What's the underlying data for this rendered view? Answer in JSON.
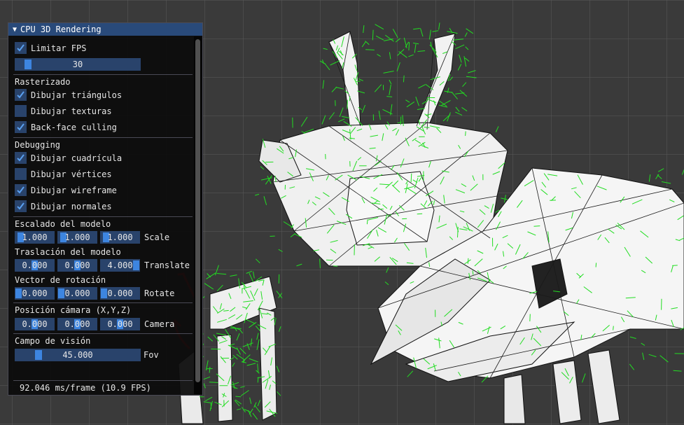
{
  "window": {
    "title": "CPU 3D Rendering",
    "limit_fps": {
      "label": "Limitar FPS",
      "checked": true
    },
    "fps_slider": {
      "value": "30",
      "fraction": 0.1
    },
    "rasterized": {
      "header": "Rasterizado",
      "items": [
        {
          "label": "Dibujar triángulos",
          "checked": true
        },
        {
          "label": "Dibujar texturas",
          "checked": false
        },
        {
          "label": "Back-face culling",
          "checked": true
        }
      ]
    },
    "debugging": {
      "header": "Debugging",
      "items": [
        {
          "label": "Dibujar cuadrícula",
          "checked": true
        },
        {
          "label": "Dibujar vértices",
          "checked": false
        },
        {
          "label": "Dibujar wireframe",
          "checked": true
        },
        {
          "label": "Dibujar normales",
          "checked": true
        }
      ]
    },
    "scale": {
      "header": "Escalado del modelo",
      "values": [
        "1.000",
        "1.000",
        "1.000"
      ],
      "label": "Scale"
    },
    "translate": {
      "header": "Traslación del modelo",
      "values": [
        "0.000",
        "0.000",
        "4.000"
      ],
      "label": "Translate"
    },
    "rotate": {
      "header": "Vector de rotación",
      "values": [
        "0.000",
        "0.000",
        "0.000"
      ],
      "label": "Rotate"
    },
    "camera": {
      "header": "Posición cámara (X,Y,Z)",
      "values": [
        "0.000",
        "0.000",
        "0.000"
      ],
      "label": "Camera"
    },
    "fov": {
      "header": "Campo de visión",
      "value": "45.000",
      "label": "Fov",
      "fraction": 0.18
    },
    "status": "92.046 ms/frame (10.9 FPS)"
  },
  "colors": {
    "background": "#3a3a3a",
    "grid": "#5a5a5a",
    "mesh_fill": "#f2f2f2",
    "wireframe": "#1a1a1a",
    "normals": "#22dd22",
    "annotation": "#dd1111",
    "titlebar": "#294a7a",
    "frame": "#29436b",
    "grab": "#3d85e0"
  }
}
